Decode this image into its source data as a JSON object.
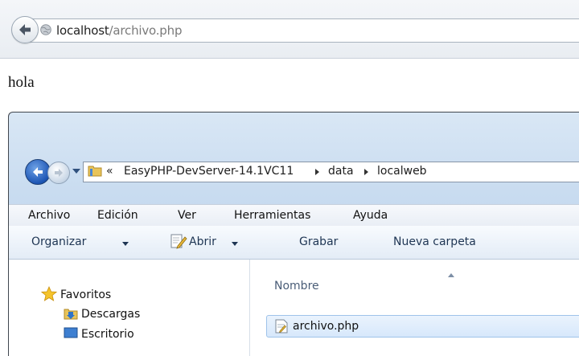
{
  "browser": {
    "url_host": "localhost",
    "url_path": "/archivo.php"
  },
  "page": {
    "text": "hola"
  },
  "explorer": {
    "breadcrumb": {
      "overflow": "«",
      "parts": [
        "EasyPHP-DevServer-14.1VC11",
        "data",
        "localweb"
      ]
    },
    "menu": [
      "Archivo",
      "Edición",
      "Ver",
      "Herramientas",
      "Ayuda"
    ],
    "toolbar": {
      "organize": "Organizar",
      "open": "Abrir",
      "burn": "Grabar",
      "new_folder": "Nueva carpeta"
    },
    "nav": {
      "favorites": "Favoritos",
      "downloads": "Descargas",
      "desktop": "Escritorio"
    },
    "column_header": "Nombre",
    "files": [
      {
        "name": "archivo.php"
      }
    ]
  },
  "colors": {
    "selection": "#d7e8fb",
    "window_frame": "#c6daef"
  }
}
